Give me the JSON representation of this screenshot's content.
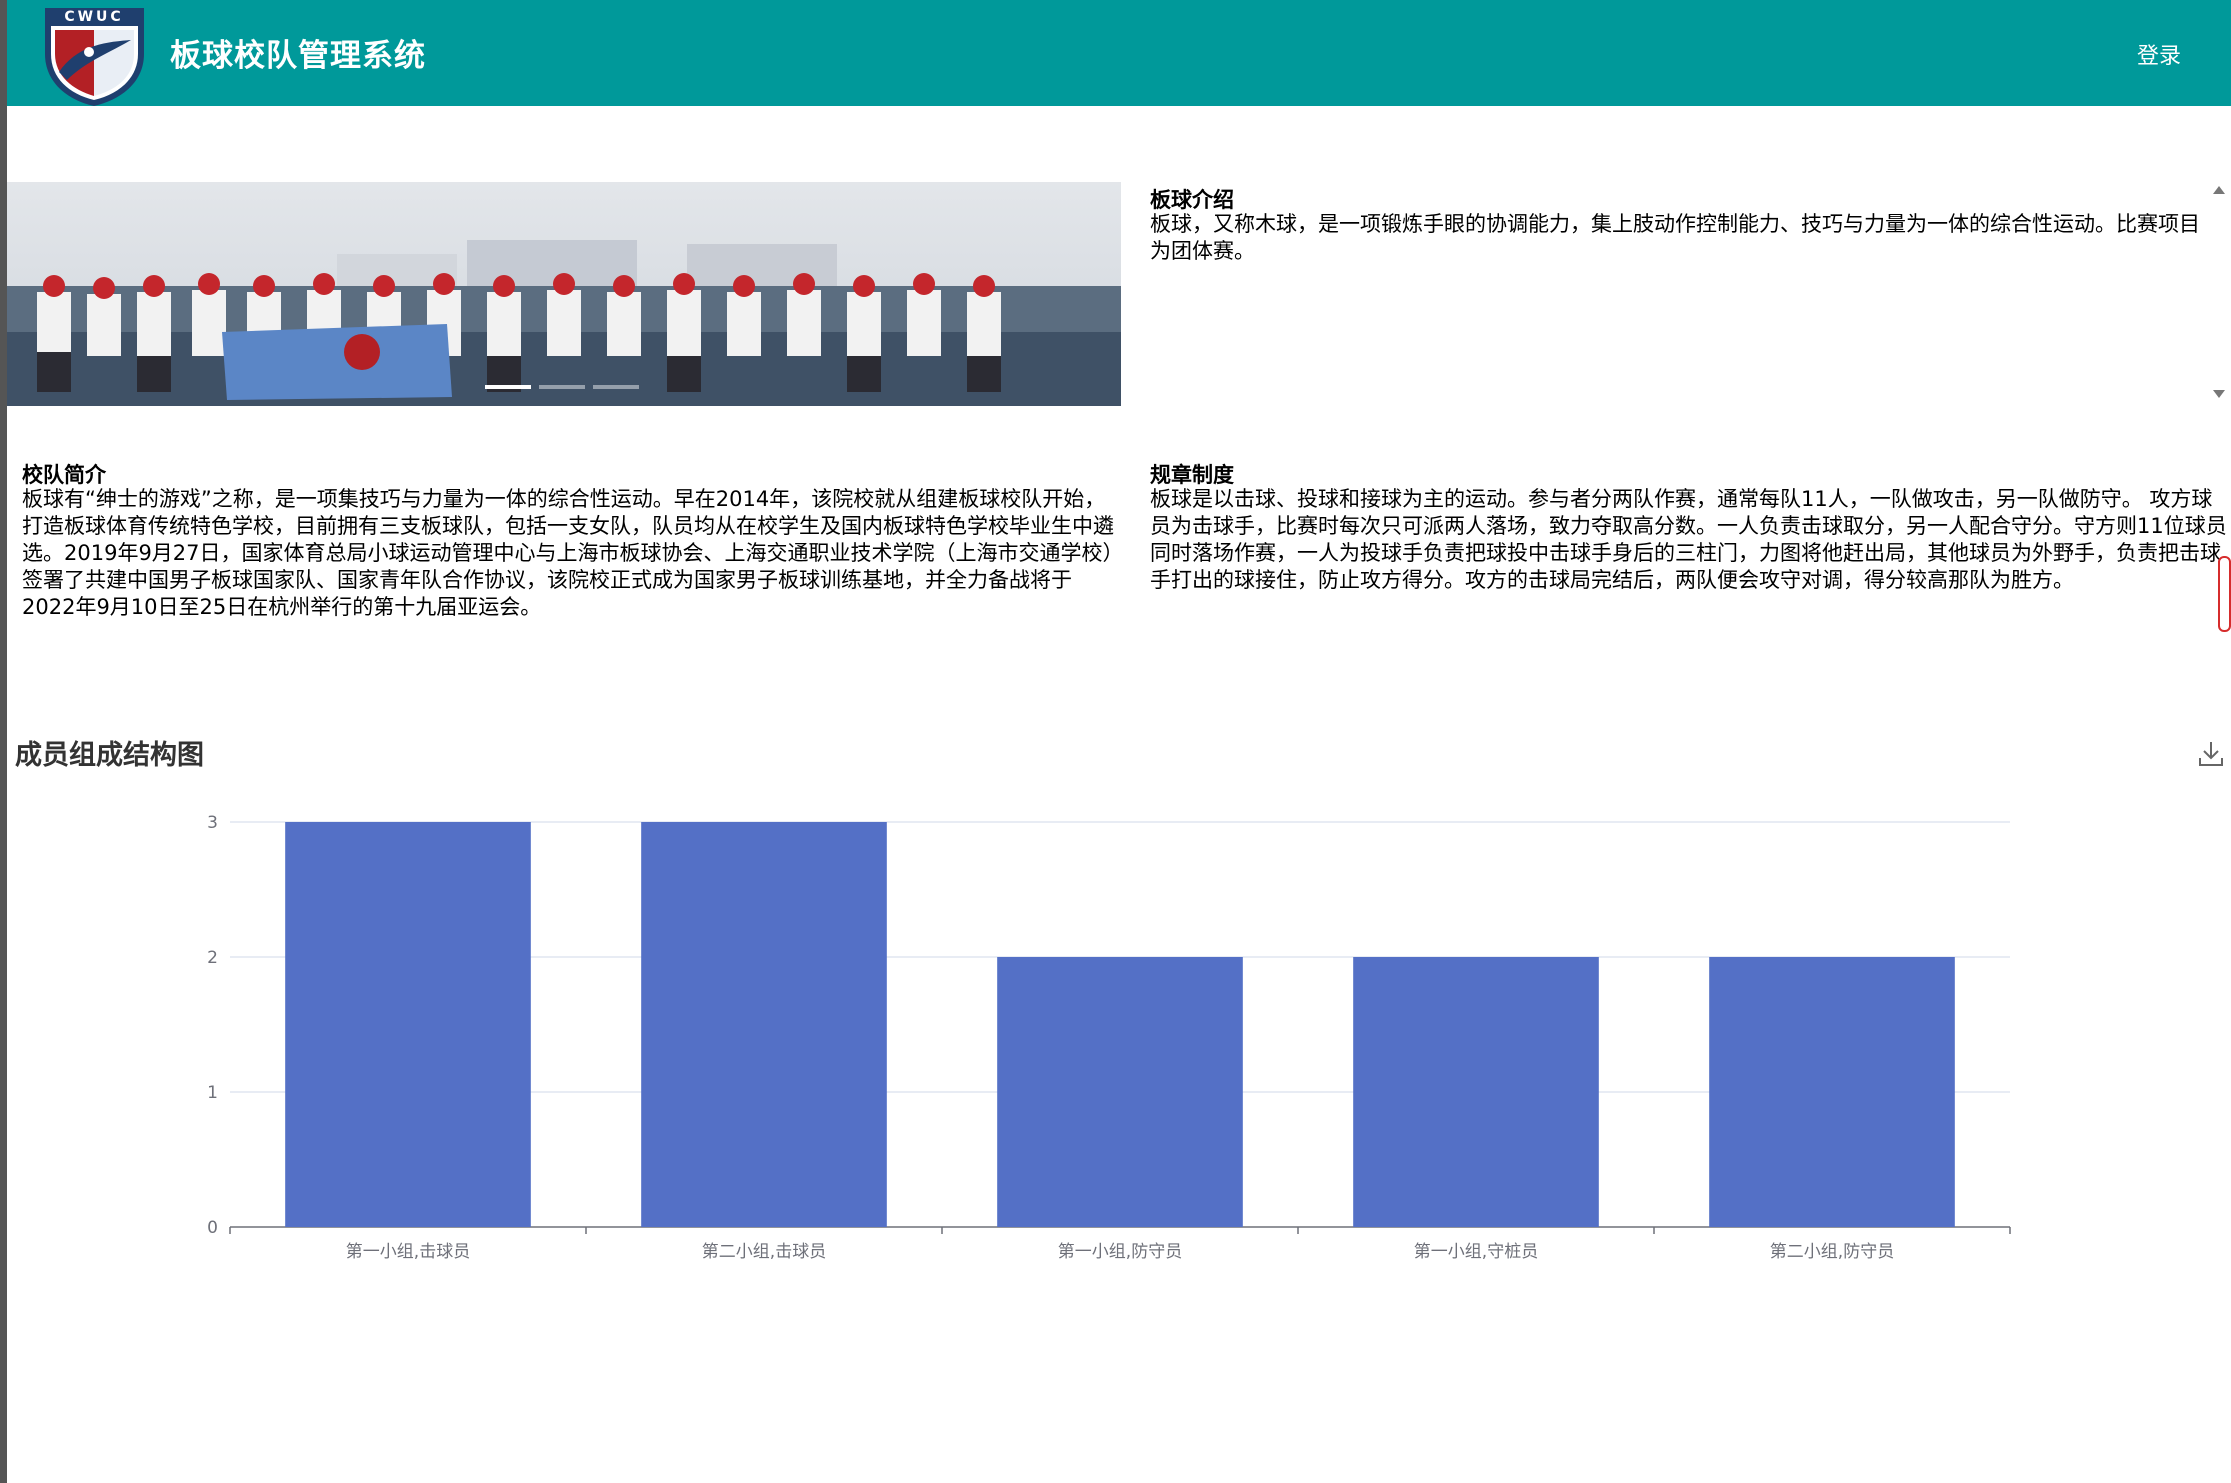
{
  "header": {
    "logo_text": "CWUC",
    "title": "板球校队管理系统",
    "login_label": "登录"
  },
  "carousel": {
    "slide_count": 3,
    "active_index": 0
  },
  "intro": {
    "title": "板球介绍",
    "text": "板球，又称木球，是一项锻炼手眼的协调能力，集上肢动作控制能力、技巧与力量为一体的综合性运动。比赛项目为团体赛。"
  },
  "team": {
    "title": "校队简介",
    "text": "板球有“绅士的游戏”之称，是一项集技巧与力量为一体的综合性运动。早在2014年，该院校就从组建板球校队开始，打造板球体育传统特色学校，目前拥有三支板球队，包括一支女队，队员均从在校学生及国内板球特色学校毕业生中遴选。2019年9月27日，国家体育总局小球运动管理中心与上海市板球协会、上海交通职业技术学院（上海市交通学校）签署了共建中国男子板球国家队、国家青年队合作协议，该院校正式成为国家男子板球训练基地，并全力备战将于2022年9月10日至25日在杭州举行的第十九届亚运会。"
  },
  "rules": {
    "title": "规章制度",
    "text": "板球是以击球、投球和接球为主的运动。参与者分两队作赛，通常每队11人，一队做攻击，另一队做防守。 攻方球员为击球手，比赛时每次只可派两人落场，致力夺取高分数。一人负责击球取分，另一人配合守分。守方则11位球员同时落场作赛，一人为投球手负责把球投中击球手身后的三柱门，力图将他赶出局，其他球员为外野手，负责把击球手打出的球接住，防止攻方得分。攻方的击球局完结后，两队便会攻守对调，得分较高那队为胜方。"
  },
  "chart_data": {
    "type": "bar",
    "title": "成员组成结构图",
    "categories": [
      "第一小组,击球员",
      "第二小组,击球员",
      "第一小组,防守员",
      "第一小组,守桩员",
      "第二小组,防守员"
    ],
    "values": [
      3,
      3,
      2,
      2,
      2
    ],
    "ylim": [
      0,
      3
    ],
    "yticks": [
      0,
      1,
      2,
      3
    ],
    "grid": true,
    "bar_color": "#5470c6"
  },
  "icons": {
    "download": "download-icon"
  },
  "colors": {
    "header_bg": "#00999a",
    "bar": "#5470c6"
  }
}
